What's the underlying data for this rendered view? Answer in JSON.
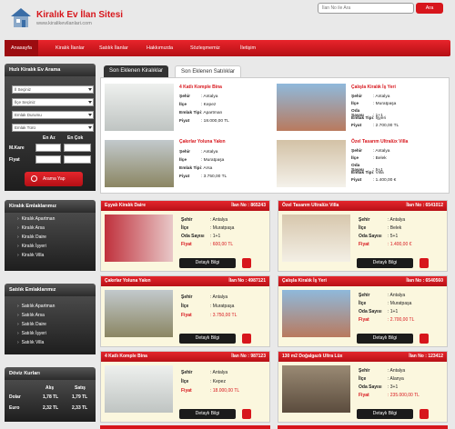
{
  "header": {
    "title": "Kiralık Ev İlan Sitesi",
    "url": "www.kiralikevilanlari.com",
    "search_placeholder": "İlan No ile Ara",
    "search_button": "Ara",
    "brand_color": "#d7161c"
  },
  "nav": {
    "items": [
      "Anasayfa",
      "Kiralık İlanlar",
      "Satılık İlanlar",
      "Hakkımızda",
      "Sözleşmemiz",
      "İletişim"
    ]
  },
  "search_panel": {
    "title": "Hızlı Kiralık Ev Arama",
    "city": "İl Seçiniz",
    "district": "İlçe Seçiniz",
    "status": "Emlak Durumu",
    "type": "Emlak Türü",
    "col_min": "En Az",
    "col_max": "En Çok",
    "m2_label": "M.Kare",
    "price_label": "Fiyat",
    "button": "Arama Yap"
  },
  "rent_panel": {
    "title": "Kiralık Emlaklarımız",
    "items": [
      "Kiralık Apartman",
      "Kiralık Arsa",
      "Kiralık Daire",
      "Kiralık İşyeri",
      "Kiralık Villa"
    ]
  },
  "sale_panel": {
    "title": "Satılık Emlaklarımız",
    "items": [
      "Satılık Apartman",
      "Satılık Arsa",
      "Satılık Daire",
      "Satılık İşyeri",
      "Satılık Villa"
    ]
  },
  "currency": {
    "title": "Döviz Kurları",
    "buy": "Alış",
    "sell": "Satış",
    "rows": [
      {
        "name": "Dolar",
        "buy": "1,78 TL",
        "sell": "1,79 TL"
      },
      {
        "name": "Euro",
        "buy": "2,32 TL",
        "sell": "2,33 TL"
      }
    ]
  },
  "tabs": [
    "Son Eklenen Kiralıklar",
    "Son Eklenen Satılıklar"
  ],
  "labels": {
    "city": "Şehir",
    "district": "İlçe",
    "type": "Emlak Tipi",
    "price": "Fiyat",
    "rooms": "Oda Sayısı",
    "listing_no": "İlan No :",
    "details": "Detaylı Bilgi"
  },
  "featured": [
    {
      "title": "4 Katlı Komple Bina",
      "city": ": Antalya",
      "district": ": Kepez",
      "type_label": "Emlak Tipi",
      "type": ": Apartman",
      "price": ": 18.000,00 TL"
    },
    {
      "title": "Çalışla Kiralık İş Yeri",
      "city": ": Antalya",
      "district": ": Muratpaşa",
      "rooms": ": 1+1",
      "type_label": "Emlak Tipi",
      "type": ": İşyeri",
      "price": ": 2.700,00 TL"
    },
    {
      "title": "Çakırlar Yoluna Yakın",
      "city": ": Antalya",
      "district": ": Muratpaşa",
      "type_label": "Emlak Tipi",
      "type": ": Arsa",
      "price": ": 3.750,00 TL"
    },
    {
      "title": "Özel Tasarım Ultralüx Villa",
      "city": ": Antalya",
      "district": ": Belek",
      "rooms": ": 5+1",
      "type_label": "Emlak Tipi",
      "type": ": Villa",
      "price": ": 1.400,00 €"
    }
  ],
  "cards": [
    {
      "title": "Eşyalı Kiralık Daire",
      "no": "865243",
      "city": ": Antalya",
      "district": ": Muratpaşa",
      "rooms": ": 1+1",
      "price": ": 600,00 TL"
    },
    {
      "title": "Özel Tasarım Ultralüx Villa",
      "no": "6541012",
      "city": ": Antalya",
      "district": ": Belek",
      "rooms": ": 5+1",
      "price": ": 1.400,00 €"
    },
    {
      "title": "Çakırlar Yoluna Yakın",
      "no": "4987121",
      "city": ": Antalya",
      "district": ": Muratpaşa",
      "price": ": 3.750,00 TL"
    },
    {
      "title": "Çalışla Kiralık İş Yeri",
      "no": "6540560",
      "city": ": Antalya",
      "district": ": Muratpaşa",
      "rooms": ": 1+1",
      "price": ": 2.700,00 TL"
    },
    {
      "title": "4 Katlı Komple Bina",
      "no": "987123",
      "city": ": Antalya",
      "district": ": Kepez",
      "price": ": 18.000,00 TL"
    },
    {
      "title": "130 m2 Doğalgazlı Ultra Lüx",
      "no": "123412",
      "city": ": Antalya",
      "district": ": Alanya",
      "rooms": ": 3+1",
      "price": ": 235.000,00 TL"
    }
  ]
}
